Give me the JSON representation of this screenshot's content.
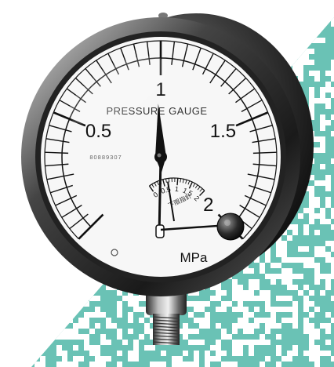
{
  "gauge": {
    "brand_text": "PRESSURE GAUGE",
    "serial_number": "80889307",
    "unit": "MPa",
    "scale": {
      "min": 0,
      "max": 2,
      "major_labels": [
        "0.5",
        "1",
        "1.5",
        "2"
      ]
    },
    "needle_value": 0.98,
    "sub_dial": {
      "labels": [
        "0",
        "0.5",
        "1",
        "1.5",
        "2"
      ],
      "caption": "下限指針",
      "needle_value": 0.65
    }
  },
  "colors": {
    "background": "#ffffff",
    "pattern": "#62bfb1",
    "bezel": "#1e1e1e",
    "dial_face": "#f7f7f7",
    "ink": "#111111"
  }
}
